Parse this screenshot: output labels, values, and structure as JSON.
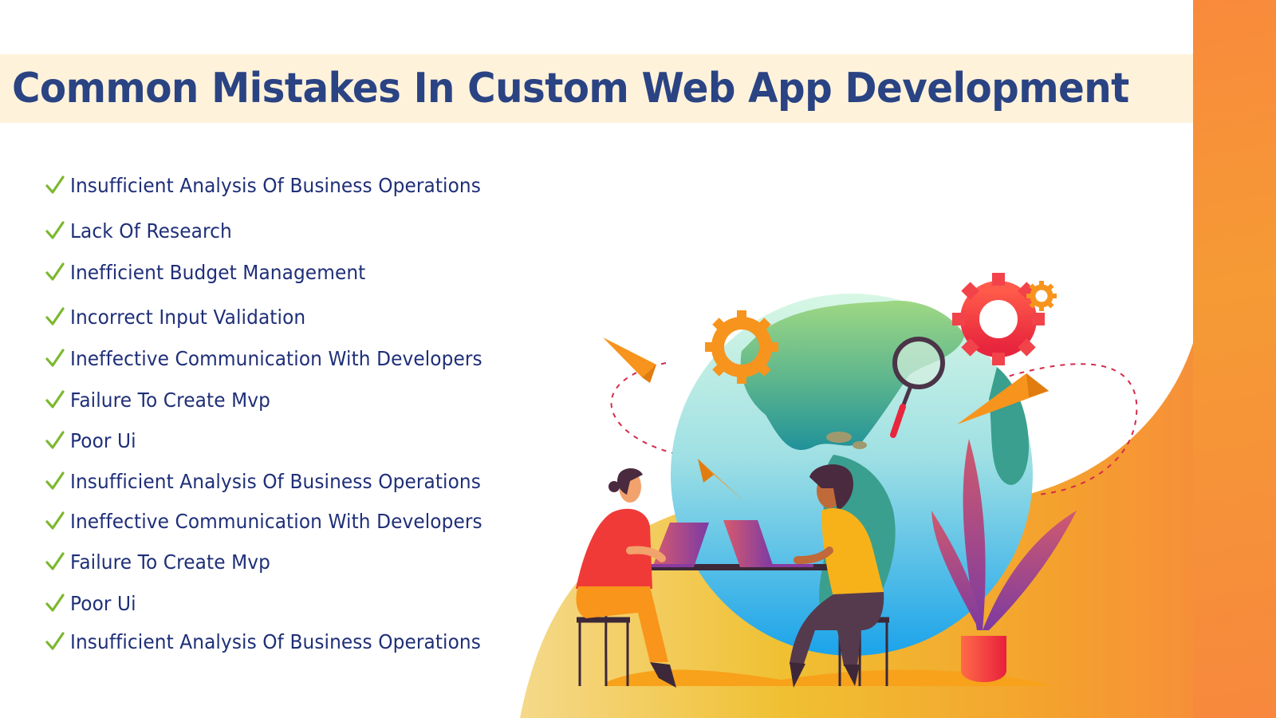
{
  "header": {
    "title": "Common Mistakes In Custom Web App Development"
  },
  "mistakes": {
    "icon": "checkmark-icon",
    "items": [
      "Insufficient Analysis Of Business Operations",
      "Lack Of Research",
      "Inefficient Budget Management",
      "Incorrect Input Validation",
      "Ineffective Communication With Developers",
      "Failure To Create Mvp",
      "Poor Ui",
      "Insufficient Analysis Of Business Operations",
      "Ineffective Communication With Developers",
      "Failure To Create Mvp",
      "Poor Ui",
      "Insufficient Analysis Of Business Operations"
    ]
  },
  "illustration": {
    "description": "Two developers working on laptops at a table in front of a globe with gears, magnifying glass, paper planes and a potted plant",
    "elements": [
      "globe",
      "orange-gear",
      "red-gear",
      "small-orange-gear",
      "magnifying-glass",
      "paper-plane",
      "paper-plane",
      "paper-plane",
      "developer-woman",
      "developer-man",
      "laptop",
      "laptop",
      "desk",
      "stool",
      "stool",
      "potted-plant"
    ]
  },
  "colors": {
    "title": "#2a4383",
    "title_band": "#fef2db",
    "list_text": "#1f2f78",
    "check": "#7cb82f",
    "accent_orange": "#f7883d",
    "accent_yellow": "#f0c240"
  }
}
